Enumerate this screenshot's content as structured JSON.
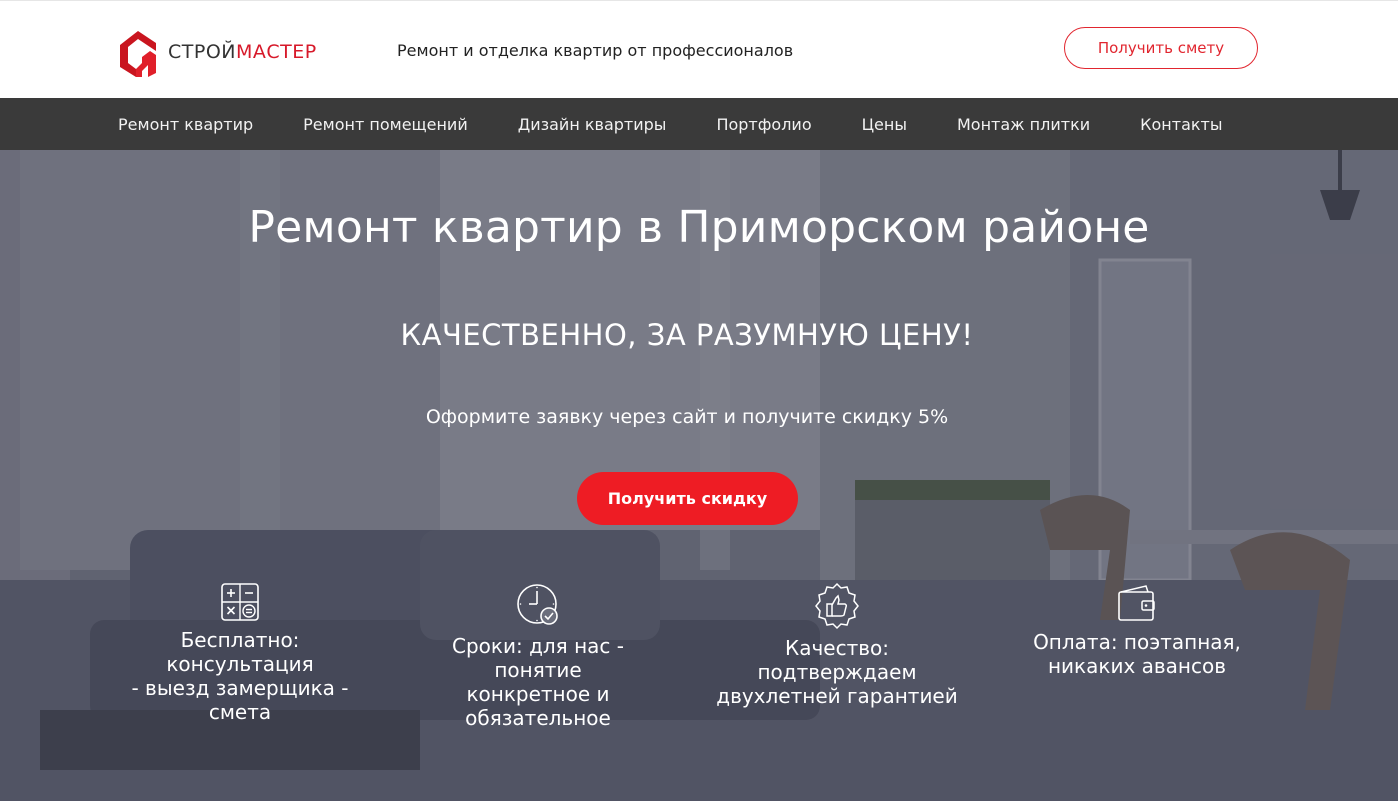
{
  "header": {
    "logo": {
      "part1": "СТРОЙ",
      "part2": "МАСТЕР"
    },
    "tagline": "Ремонт и отделка квартир от профессионалов",
    "estimate_button": "Получить смету"
  },
  "nav": {
    "items": [
      {
        "label": "Ремонт квартир"
      },
      {
        "label": "Ремонт помещений"
      },
      {
        "label": "Дизайн квартиры"
      },
      {
        "label": "Портфолио"
      },
      {
        "label": "Цены"
      },
      {
        "label": "Монтаж плитки"
      },
      {
        "label": "Контакты"
      }
    ]
  },
  "hero": {
    "title": "Ремонт квартир в Приморском районе",
    "subtitle": "КАЧЕСТВЕННО, ЗА РАЗУМНУЮ ЦЕНУ!",
    "note": "Оформите заявку через сайт и  получите скидку 5%",
    "cta_button": "Получить скидку"
  },
  "features": [
    {
      "icon": "calculator-icon",
      "text": "Бесплатно:\nконсультация\n- выезд замерщика -\nсмета"
    },
    {
      "icon": "clock-check-icon",
      "text": "Сроки: для нас -\nпонятие\nконкретное и\nобязательное"
    },
    {
      "icon": "thumbs-up-badge-icon",
      "text": "Качество:\nподтверждаем\nдвухлетней гарантией"
    },
    {
      "icon": "wallet-icon",
      "text": "Оплата: поэтапная,\nникаких авансов"
    }
  ],
  "colors": {
    "accent": "#ee1c24",
    "nav_bg": "#3a3a3a",
    "logo_red": "#d7192a"
  }
}
